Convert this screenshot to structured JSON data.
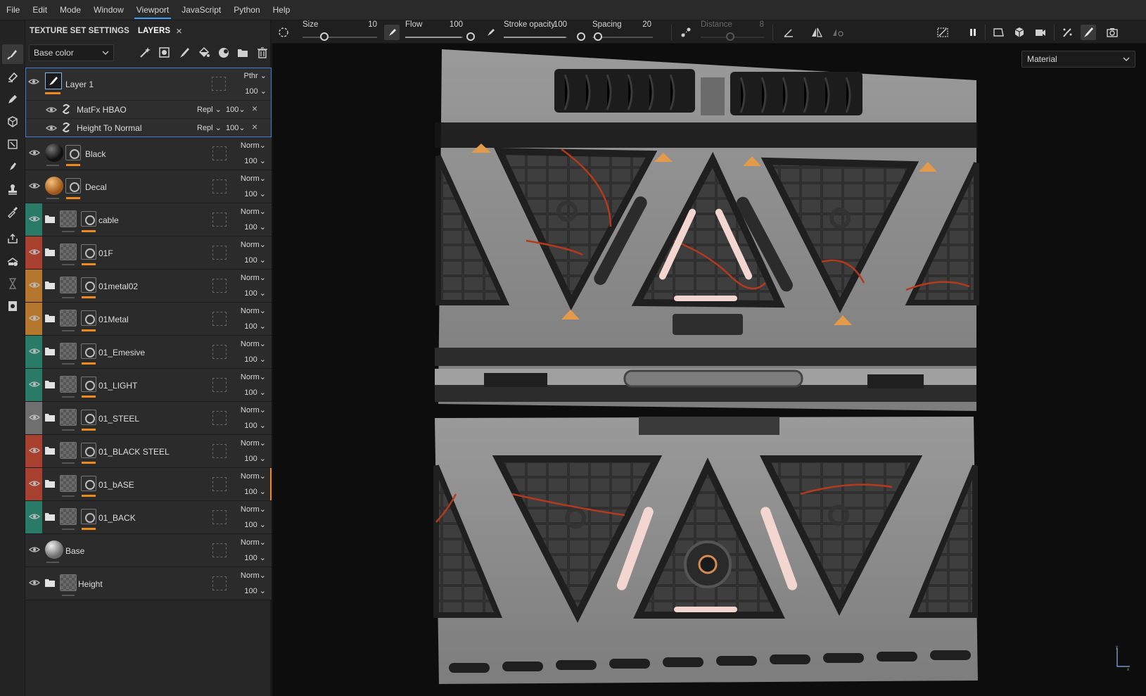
{
  "menu": [
    "File",
    "Edit",
    "Mode",
    "Window",
    "Viewport",
    "JavaScript",
    "Python",
    "Help"
  ],
  "menu_active": "Viewport",
  "panel": {
    "tab_settings": "TEXTURE SET SETTINGS",
    "tab_layers": "LAYERS",
    "tab_close": "×",
    "channel": "Base color",
    "layer1": {
      "name": "Layer 1",
      "blend": "Pthr",
      "opacity": "100",
      "effects": [
        {
          "name": "MatFx HBAO",
          "blend": "Repl",
          "opacity": "100"
        },
        {
          "name": "Height To Normal",
          "blend": "Repl",
          "opacity": "100"
        }
      ]
    },
    "layers": [
      {
        "name": "Black",
        "blend": "Norm",
        "opacity": "100",
        "kind": "fill-black",
        "color": ""
      },
      {
        "name": "Decal",
        "blend": "Norm",
        "opacity": "100",
        "kind": "fill-copper",
        "color": ""
      },
      {
        "name": "cable",
        "blend": "Norm",
        "opacity": "100",
        "kind": "folder",
        "color": "#2a7a68"
      },
      {
        "name": "01F",
        "blend": "Norm",
        "opacity": "100",
        "kind": "folder",
        "color": "#a8402f"
      },
      {
        "name": "01metal02",
        "blend": "Norm",
        "opacity": "100",
        "kind": "folder",
        "color": "#b5772e"
      },
      {
        "name": "01Metal",
        "blend": "Norm",
        "opacity": "100",
        "kind": "folder",
        "color": "#b5772e"
      },
      {
        "name": "01_Emesive",
        "blend": "Norm",
        "opacity": "100",
        "kind": "folder",
        "color": "#2a7a68"
      },
      {
        "name": "01_LIGHT",
        "blend": "Norm",
        "opacity": "100",
        "kind": "folder",
        "color": "#2a7a68"
      },
      {
        "name": "01_STEEL",
        "blend": "Norm",
        "opacity": "100",
        "kind": "folder",
        "color": "#6f6f6f"
      },
      {
        "name": "01_BLACK STEEL",
        "blend": "Norm",
        "opacity": "100",
        "kind": "folder",
        "color": "#a8402f"
      },
      {
        "name": "01_bASE",
        "blend": "Norm",
        "opacity": "100",
        "kind": "folder",
        "color": "#a8402f"
      },
      {
        "name": "01_BACK",
        "blend": "Norm",
        "opacity": "100",
        "kind": "folder",
        "color": "#2a7a68"
      },
      {
        "name": "Base",
        "blend": "Norm",
        "opacity": "100",
        "kind": "fill-grey",
        "color": ""
      },
      {
        "name": "Height",
        "blend": "Norm",
        "opacity": "100",
        "kind": "folder-plain",
        "color": ""
      }
    ]
  },
  "brush": {
    "size_label": "Size",
    "size_value": "10",
    "flow_label": "Flow",
    "flow_value": "100",
    "stroke_label": "Stroke opacity",
    "stroke_value": "100",
    "spacing_label": "Spacing",
    "spacing_value": "20",
    "distance_label": "Distance",
    "distance_value": "8"
  },
  "viewport": {
    "material_mode": "Material"
  },
  "colors": {
    "accent": "#3d9df5",
    "orange": "#ee8a1c",
    "selection": "#3d7fd6"
  }
}
